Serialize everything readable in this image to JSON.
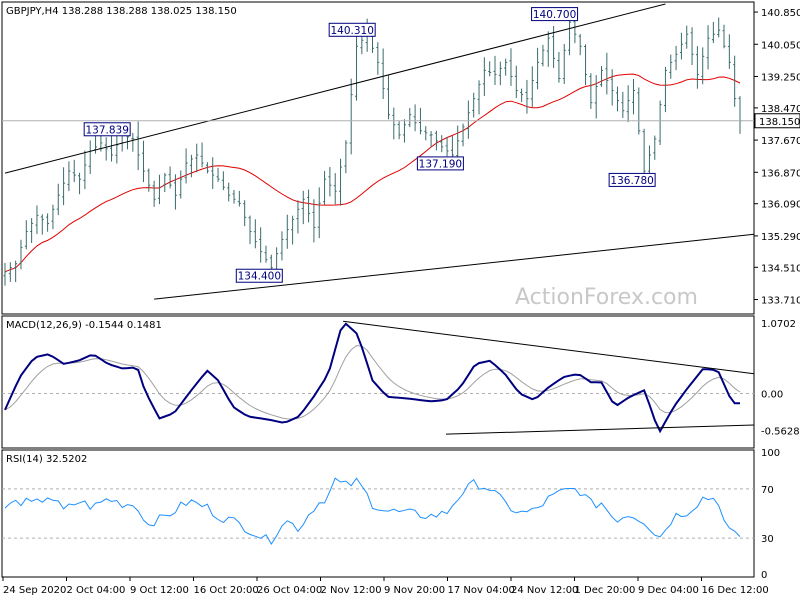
{
  "chart_data": {
    "type": "candlestick",
    "symbol_header": "GBPJPY,H4  138.288 138.288 138.025 138.150",
    "current_price": "138.150",
    "watermark": "ActionForex.com",
    "x_tick_labels": [
      "24 Sep 2020",
      "2 Oct 04:00",
      "9 Oct 12:00",
      "16 Oct 20:00",
      "26 Oct 04:00",
      "2 Nov 12:00",
      "9 Nov 20:00",
      "17 Nov 04:00",
      "24 Nov 12:00",
      "1 Dec 20:00",
      "9 Dec 04:00",
      "16 Dec 12:00"
    ],
    "price_panel": {
      "ylim": [
        133.4,
        141.05
      ],
      "y_ticks": [
        "140.850",
        "140.050",
        "139.250",
        "138.470",
        "137.670",
        "136.870",
        "136.090",
        "135.290",
        "134.510",
        "133.710"
      ],
      "moving_average_color": "#e00000",
      "bar_color": "#3a6b6b",
      "annotations": [
        {
          "label": "137.839",
          "price": 137.839
        },
        {
          "label": "140.310",
          "price": 140.31
        },
        {
          "label": "140.700",
          "price": 140.7
        },
        {
          "label": "137.190",
          "price": 137.19
        },
        {
          "label": "136.780",
          "price": 136.78
        },
        {
          "label": "134.400",
          "price": 134.4
        }
      ],
      "trendlines": [
        {
          "from_bar": 0,
          "from_price": 136.85,
          "to_bar": 124,
          "to_price": 141.05
        },
        {
          "from_bar": 28,
          "from_price": 133.72,
          "to_bar": 200,
          "to_price": 136.18
        }
      ]
    },
    "macd_panel": {
      "title": "MACD(12,26,9) -0.1544 0.1481",
      "ylim": [
        -0.8,
        1.15
      ],
      "y_ticks": [
        "1.0702",
        "0.00",
        "-0.5628"
      ],
      "macd_color": "#000080",
      "signal_color": "#a0a0a0",
      "anchors": [
        [
          0,
          -0.25
        ],
        [
          4,
          0.25
        ],
        [
          8,
          0.55
        ],
        [
          12,
          0.6
        ],
        [
          16,
          0.45
        ],
        [
          20,
          0.5
        ],
        [
          24,
          0.6
        ],
        [
          28,
          0.45
        ],
        [
          32,
          0.38
        ],
        [
          36,
          0.4
        ],
        [
          38,
          0.05
        ],
        [
          42,
          -0.38
        ],
        [
          46,
          -0.3
        ],
        [
          50,
          0.0
        ],
        [
          55,
          0.35
        ],
        [
          58,
          0.2
        ],
        [
          62,
          -0.2
        ],
        [
          66,
          -0.35
        ],
        [
          72,
          -0.4
        ],
        [
          76,
          -0.45
        ],
        [
          80,
          -0.35
        ],
        [
          84,
          -0.05
        ],
        [
          88,
          0.3
        ],
        [
          92,
          1.1
        ],
        [
          96,
          0.9
        ],
        [
          100,
          0.2
        ],
        [
          104,
          -0.05
        ],
        [
          110,
          -0.08
        ],
        [
          116,
          -0.12
        ],
        [
          120,
          -0.1
        ],
        [
          124,
          0.1
        ],
        [
          128,
          0.45
        ],
        [
          132,
          0.5
        ],
        [
          136,
          0.3
        ],
        [
          140,
          0.0
        ],
        [
          144,
          -0.1
        ],
        [
          148,
          0.1
        ],
        [
          152,
          0.25
        ],
        [
          156,
          0.3
        ],
        [
          160,
          0.15
        ],
        [
          162,
          0.2
        ],
        [
          166,
          -0.2
        ],
        [
          170,
          -0.05
        ],
        [
          174,
          0.05
        ],
        [
          178,
          -0.6
        ],
        [
          182,
          -0.2
        ],
        [
          186,
          0.1
        ],
        [
          190,
          0.38
        ],
        [
          194,
          0.35
        ],
        [
          196,
          0.1
        ],
        [
          198,
          -0.15
        ]
      ],
      "trendlines": [
        {
          "from_bar": 92,
          "from_value": 1.1,
          "to_bar": 200,
          "to_value": 0.3
        },
        {
          "from_bar": 120,
          "from_value": -0.62,
          "to_bar": 200,
          "to_value": -0.48
        }
      ]
    },
    "rsi_panel": {
      "title": "RSI(14) 32.5202",
      "ylim": [
        0,
        100
      ],
      "y_ticks": [
        "100",
        "70",
        "30",
        "0"
      ],
      "levels": [
        70,
        30
      ],
      "line_color": "#1e90ff",
      "anchors": [
        [
          0,
          55
        ],
        [
          4,
          60
        ],
        [
          8,
          57
        ],
        [
          12,
          65
        ],
        [
          16,
          52
        ],
        [
          20,
          60
        ],
        [
          24,
          55
        ],
        [
          28,
          62
        ],
        [
          32,
          58
        ],
        [
          36,
          57
        ],
        [
          38,
          42
        ],
        [
          42,
          45
        ],
        [
          46,
          52
        ],
        [
          50,
          60
        ],
        [
          55,
          55
        ],
        [
          58,
          48
        ],
        [
          62,
          44
        ],
        [
          66,
          38
        ],
        [
          72,
          27
        ],
        [
          76,
          45
        ],
        [
          80,
          38
        ],
        [
          84,
          55
        ],
        [
          88,
          65
        ],
        [
          90,
          78
        ],
        [
          92,
          72
        ],
        [
          96,
          76
        ],
        [
          100,
          58
        ],
        [
          104,
          52
        ],
        [
          110,
          50
        ],
        [
          116,
          48
        ],
        [
          120,
          50
        ],
        [
          124,
          66
        ],
        [
          128,
          75
        ],
        [
          132,
          70
        ],
        [
          136,
          58
        ],
        [
          140,
          50
        ],
        [
          144,
          52
        ],
        [
          148,
          62
        ],
        [
          152,
          68
        ],
        [
          156,
          70
        ],
        [
          160,
          56
        ],
        [
          162,
          60
        ],
        [
          166,
          45
        ],
        [
          170,
          50
        ],
        [
          174,
          44
        ],
        [
          178,
          30
        ],
        [
          182,
          48
        ],
        [
          186,
          52
        ],
        [
          190,
          63
        ],
        [
          194,
          62
        ],
        [
          196,
          40
        ],
        [
          198,
          32
        ]
      ]
    },
    "close_anchors": [
      [
        0,
        134.4
      ],
      [
        2,
        134.6
      ],
      [
        4,
        135.4
      ],
      [
        6,
        135.8
      ],
      [
        8,
        135.6
      ],
      [
        10,
        136.3
      ],
      [
        12,
        136.9
      ],
      [
        14,
        136.7
      ],
      [
        16,
        137.4
      ],
      [
        18,
        137.6
      ],
      [
        20,
        137.3
      ],
      [
        22,
        137.8
      ],
      [
        24,
        137.7
      ],
      [
        26,
        136.9
      ],
      [
        28,
        136.2
      ],
      [
        30,
        136.8
      ],
      [
        32,
        136.3
      ],
      [
        34,
        137.1
      ],
      [
        36,
        137.3
      ],
      [
        38,
        136.9
      ],
      [
        40,
        136.7
      ],
      [
        42,
        136.3
      ],
      [
        44,
        136.1
      ],
      [
        46,
        135.4
      ],
      [
        48,
        134.9
      ],
      [
        50,
        134.5
      ],
      [
        52,
        135.2
      ],
      [
        54,
        135.7
      ],
      [
        56,
        136.2
      ],
      [
        58,
        135.5
      ],
      [
        60,
        136.7
      ],
      [
        62,
        136.4
      ],
      [
        64,
        137.6
      ],
      [
        66,
        140.0
      ],
      [
        68,
        140.3
      ],
      [
        70,
        139.6
      ],
      [
        72,
        138.3
      ],
      [
        74,
        137.8
      ],
      [
        76,
        138.3
      ],
      [
        78,
        137.9
      ],
      [
        80,
        137.8
      ],
      [
        82,
        137.5
      ],
      [
        84,
        137.3
      ],
      [
        86,
        138.0
      ],
      [
        88,
        138.7
      ],
      [
        90,
        139.4
      ],
      [
        92,
        139.3
      ],
      [
        94,
        139.6
      ],
      [
        96,
        138.9
      ],
      [
        98,
        138.7
      ],
      [
        100,
        139.6
      ],
      [
        102,
        140.2
      ],
      [
        104,
        139.2
      ],
      [
        106,
        140.6
      ],
      [
        108,
        140.0
      ],
      [
        110,
        138.6
      ],
      [
        112,
        139.4
      ],
      [
        114,
        138.9
      ],
      [
        116,
        138.4
      ],
      [
        118,
        138.9
      ],
      [
        120,
        136.9
      ],
      [
        122,
        137.7
      ],
      [
        124,
        139.4
      ],
      [
        126,
        139.8
      ],
      [
        128,
        140.3
      ],
      [
        130,
        139.3
      ],
      [
        132,
        140.2
      ],
      [
        134,
        140.4
      ],
      [
        136,
        139.6
      ],
      [
        137,
        138.7
      ],
      [
        138,
        138.15
      ]
    ],
    "bar_count": 139
  }
}
